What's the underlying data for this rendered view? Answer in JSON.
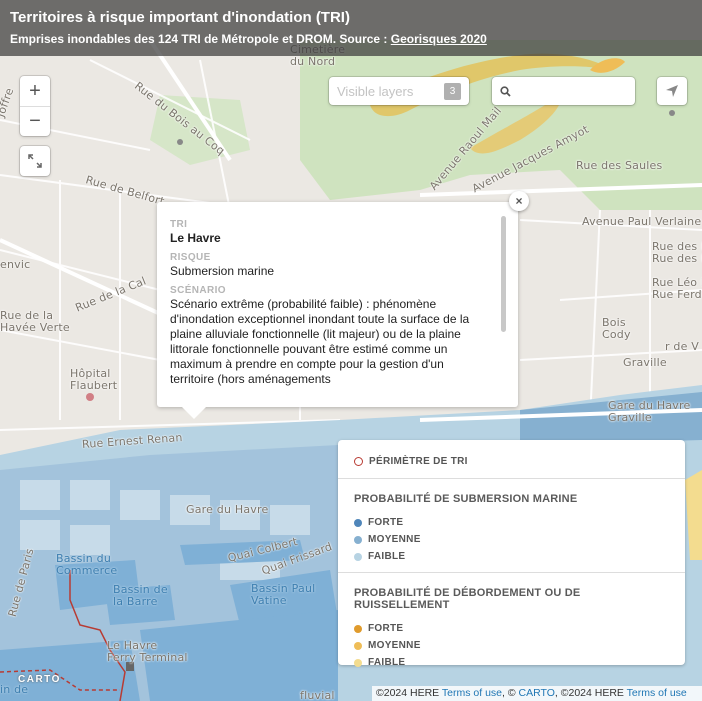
{
  "header": {
    "title": "Territoires à risque important d'inondation (TRI)",
    "subtitle_prefix": "Emprises inondables des 124 TRI de Métropole et DROM. Source : ",
    "subtitle_link": "Georisques 2020"
  },
  "controls": {
    "zoom_in": "+",
    "zoom_out": "−",
    "layers_label": "Visible layers",
    "layers_count": "3",
    "search_value": ""
  },
  "popup": {
    "close": "×",
    "fields": [
      {
        "label": "TRI",
        "value": "Le Havre"
      },
      {
        "label": "RISQUE",
        "value": "Submersion marine"
      },
      {
        "label": "SCÉNARIO",
        "value": "Scénario extrême (probabilité faible) : phénomène d'inondation exceptionnel inondant toute la surface de la plaine alluviale fonctionnelle (lit majeur) ou de la plaine littorale fonctionnelle pouvant être estimé comme un maximum à prendre en compte pour la gestion d'un territoire (hors aménagements"
      }
    ]
  },
  "legend": {
    "perimeter": {
      "label": "PÉRIMÈTRE DE TRI",
      "color": "#b83b33"
    },
    "marine": {
      "title": "PROBABILITÉ DE SUBMERSION MARINE",
      "items": [
        {
          "label": "FORTE",
          "color": "#4f86ba"
        },
        {
          "label": "MOYENNE",
          "color": "#86b0d0"
        },
        {
          "label": "FAIBLE",
          "color": "#b7d3e3"
        }
      ]
    },
    "overflow": {
      "title": "PROBABILITÉ DE DÉBORDEMENT OU DE RUISSELLEMENT",
      "items": [
        {
          "label": "FORTE",
          "color": "#e09b2d"
        },
        {
          "label": "MOYENNE",
          "color": "#efbd57"
        },
        {
          "label": "FAIBLE",
          "color": "#f3dc8f"
        }
      ]
    }
  },
  "map_labels": {
    "cimetiere": "Cimetière\ndu Nord",
    "bois_au_coq": "Rue du Bois au Coq",
    "belfort": "Rue de Belfort",
    "saules": "Rue des Saules",
    "verlaine": "Avenue Paul Verlaine",
    "iris": "Rue des Iris",
    "hortensias": "Rue des Horte",
    "leo": "Rue Léo D",
    "ferdinand": "Rue Ferdi",
    "bois_cody": "Bois\nCody",
    "graville": "Graville",
    "gare_graville": "Gare du Havre\nGraville",
    "gare_havre": "Gare du Havre",
    "hopital": "Hôpital\nFlaubert",
    "cale": "Rue de la Cal",
    "havee": "Rue de la\nHavée Verte",
    "renan": "Rue Ernest Renan",
    "bassin_commerce": "Bassin du\nCommerce",
    "bassin_barre": "Bassin de\nla Barre",
    "bassin_vatine": "Bassin Paul\nVatine",
    "ferry": "Le Havre\nFerry Terminal",
    "colbert": "Quai Colbert",
    "frissard": "Quai Frissard",
    "avenue_raoul": "Avenue Raoul Mail",
    "jacques_amyot": "Avenue Jacques Amyot",
    "envic": "envic",
    "joffre": "Joffre",
    "fluvial": "fluvial",
    "in_de": "in de",
    "r_de_v": "r de V",
    "port": "Rue de Paris"
  },
  "attribution": {
    "prefix": "©2024 HERE ",
    "terms1": "Terms of use",
    "mid1": ", © ",
    "carto": "CARTO",
    "mid2": ", ©2024 HERE ",
    "terms2": "Terms of use"
  },
  "carto_logo": "CARTO",
  "colors": {
    "accent": "#1f76b4",
    "perimeter": "#b83b33"
  }
}
